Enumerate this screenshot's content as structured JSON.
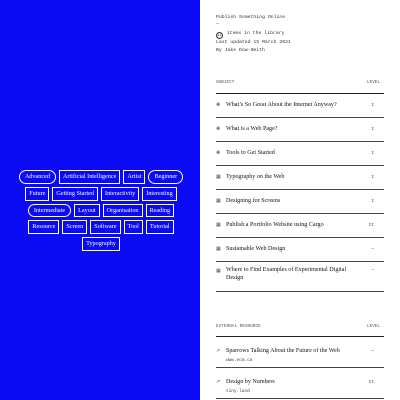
{
  "tags": [
    {
      "label": "Advanced",
      "pill": true
    },
    {
      "label": "Artificial Intelligence",
      "pill": false
    },
    {
      "label": "Artist",
      "pill": false
    },
    {
      "label": "Beginner",
      "pill": true
    },
    {
      "label": "Future",
      "pill": false
    },
    {
      "label": "Getting Started",
      "pill": false
    },
    {
      "label": "Interactivity",
      "pill": false
    },
    {
      "label": "Interesting",
      "pill": false
    },
    {
      "label": "Intermediate",
      "pill": true
    },
    {
      "label": "Layout",
      "pill": false
    },
    {
      "label": "Organisation",
      "pill": false
    },
    {
      "label": "Reading",
      "pill": false
    },
    {
      "label": "Resource",
      "pill": false
    },
    {
      "label": "Screen",
      "pill": false
    },
    {
      "label": "Software",
      "pill": false
    },
    {
      "label": "Tool",
      "pill": false
    },
    {
      "label": "Tutorial",
      "pill": false
    },
    {
      "label": "Typography",
      "pill": false
    }
  ],
  "site": {
    "title": "Publish Something Online",
    "dash": "—",
    "item_count": "11",
    "items_text": "items in the library",
    "updated": "Last updated 15 March 2021",
    "byline": "By Jake Dow-Smith"
  },
  "subject_table": {
    "col_subject": "SUBJECT",
    "col_level": "LEVEL",
    "rows": [
      {
        "icon": "❋",
        "icon_name": "asterisk-icon",
        "label": "What’s So Great About the Internet Anyway?",
        "level": "I"
      },
      {
        "icon": "❋",
        "icon_name": "asterisk-icon",
        "label": "What is a Web Page?",
        "level": "I"
      },
      {
        "icon": "❋",
        "icon_name": "asterisk-icon",
        "label": "Tools to Get Started",
        "level": "I"
      },
      {
        "icon": "▦",
        "icon_name": "grid-icon",
        "label": "Typography on the Web",
        "level": "I"
      },
      {
        "icon": "▦",
        "icon_name": "grid-icon",
        "label": "Designing for Screens",
        "level": "I"
      },
      {
        "icon": "▦",
        "icon_name": "grid-icon",
        "label": "Publish a Portfolio Website using Cargo",
        "level": "II"
      },
      {
        "icon": "▦",
        "icon_name": "grid-icon",
        "label": "Sustainable Web Design",
        "level": "—"
      },
      {
        "icon": "▦",
        "icon_name": "grid-icon",
        "label": "Where to Find Examples of Experimental Digital Design",
        "level": "—"
      }
    ]
  },
  "resource_table": {
    "col_resource": "EXTERNAL RESOURCE",
    "col_level": "LEVEL",
    "rows": [
      {
        "icon": "↗",
        "icon_name": "external-link-icon",
        "label": "Sparrows Talking About the Future of the Web",
        "url": "www.ecm.ca",
        "level": "—"
      },
      {
        "icon": "↗",
        "icon_name": "external-link-icon",
        "label": "Design by Numbers",
        "url": "tiny.land",
        "level": "II"
      }
    ]
  },
  "colors": {
    "left_panel": "#0a0af5",
    "text": "#111111"
  }
}
